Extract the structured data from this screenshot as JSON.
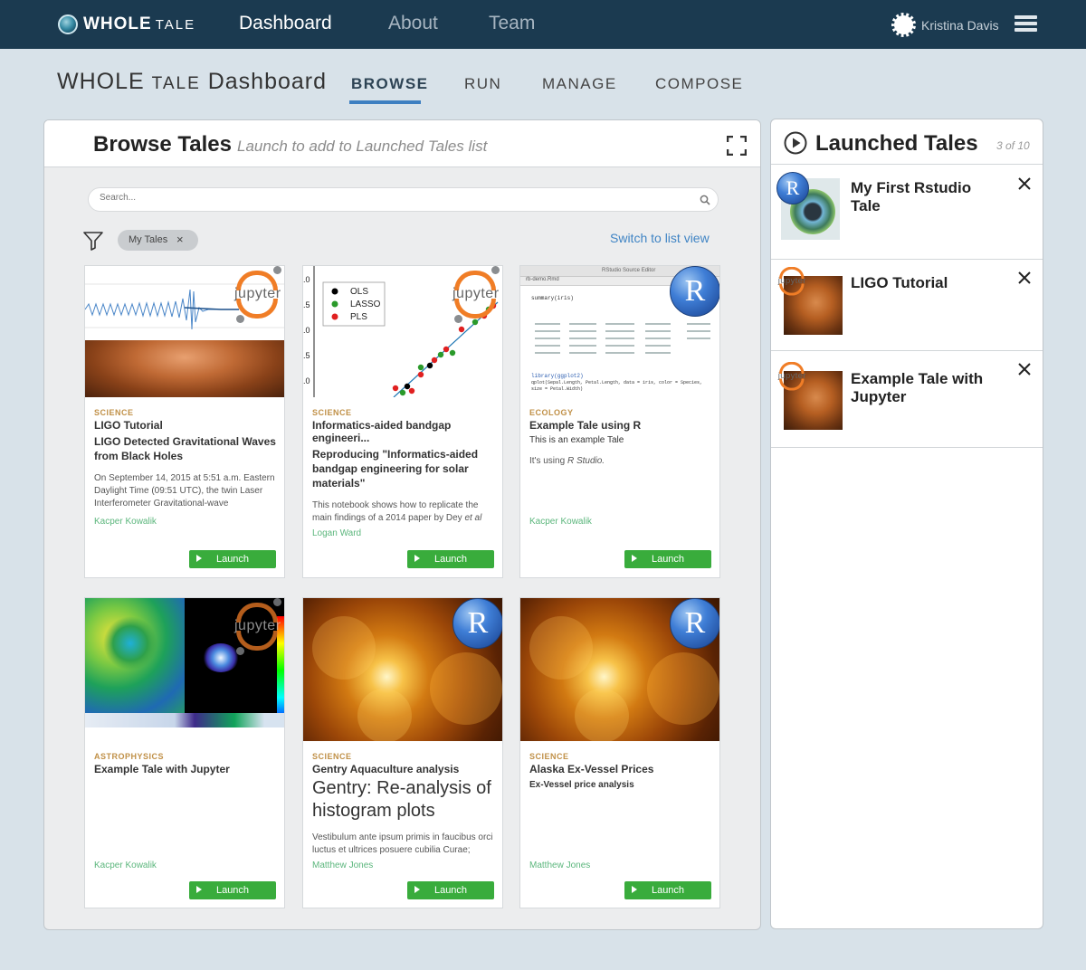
{
  "topbar": {
    "logo_main": "WHOLE",
    "logo_small": "TALE",
    "nav": [
      "Dashboard",
      "About",
      "Team"
    ],
    "user_name": "Kristina Davis"
  },
  "dashboard": {
    "title_main": "WHOLE",
    "title_small": "TALE",
    "title_rest": "Dashboard",
    "tabs": [
      "BROWSE",
      "RUN",
      "MANAGE",
      "COMPOSE"
    ],
    "active_tab": "BROWSE"
  },
  "browse": {
    "title": "Browse Tales",
    "subtitle": "Launch to add to Launched Tales list",
    "search_placeholder": "Search...",
    "filter_chip": "My Tales",
    "filter_chip_close": "×",
    "switch_view": "Switch to list view",
    "launch_label": "Launch",
    "cards": [
      {
        "category": "SCIENCE",
        "name": "LIGO Tutorial",
        "desc": "LIGO Detected Gravitational Waves from Black Holes",
        "body": "On September 14, 2015 at 5:51 a.m. Eastern Daylight Time (09:51 UTC), the twin Laser Interferometer Gravitational-wave",
        "author": "Kacper Kowalik",
        "env": "jupyter"
      },
      {
        "category": "SCIENCE",
        "name": "Informatics-aided bandgap engineeri...",
        "desc": "Reproducing \"Informatics-aided bandgap engineering for solar materials\"",
        "body_main": "This notebook shows how to replicate the main findings of a 2014 paper by Dey ",
        "body_italic": "et al",
        "author": "Logan Ward",
        "env": "jupyter"
      },
      {
        "category": "ECOLOGY",
        "name": "Example Tale using R",
        "desc": "This is an example Tale",
        "body_main": "It's using ",
        "body_italic": "R Studio.",
        "author": "Kacper Kowalik",
        "env": "R"
      },
      {
        "category": "ASTROPHYSICS",
        "name": "Example Tale with Jupyter",
        "author": "Kacper Kowalik",
        "env": "jupyter"
      },
      {
        "category": "SCIENCE",
        "name": "Gentry Aquaculture analysis",
        "big": "Gentry: Re-analysis of histogram plots",
        "body": "Vestibulum ante ipsum primis in faucibus orci luctus et ultrices posuere cubilia Curae;",
        "author": "Matthew Jones",
        "env": "R"
      },
      {
        "category": "SCIENCE",
        "name": "Alaska Ex-Vessel Prices",
        "desc": "Ex-Vessel price analysis",
        "author": "Matthew Jones",
        "env": "R"
      }
    ]
  },
  "thumb_text": {
    "legend": [
      "OLS",
      "LASSO",
      "PLS"
    ],
    "yticks": [
      ".0",
      ".5",
      ".0",
      ".5",
      ".0"
    ],
    "rstudio_title": "RStudio Source Editor",
    "rstudio_file": "rb-demo.Rmd",
    "rstudio_code": "summary(iris)",
    "rstudio_code2": "library(ggplot2)",
    "rstudio_code3": "qplot(Sepal.Length, Petal.Length, data = iris, color = Species, size = Petal.Width)"
  },
  "launched": {
    "title": "Launched Tales",
    "count": "3 of 10",
    "items": [
      {
        "name": "My First Rstudio Tale",
        "env": "R"
      },
      {
        "name": "LIGO Tutorial",
        "env": "jupyter"
      },
      {
        "name": "Example Tale with Jupyter",
        "env": "jupyter"
      }
    ]
  },
  "icons": {
    "expand": "expand-icon",
    "search": "search-icon",
    "filter": "filter-icon",
    "play": "play-circle-icon",
    "close": "close-icon",
    "menu": "server-menu-icon"
  },
  "colors": {
    "topbar": "#1b3a50",
    "accent": "#3d7fc1",
    "launch": "#39ac3c",
    "category": "#c09047",
    "author": "#5bb67c"
  }
}
